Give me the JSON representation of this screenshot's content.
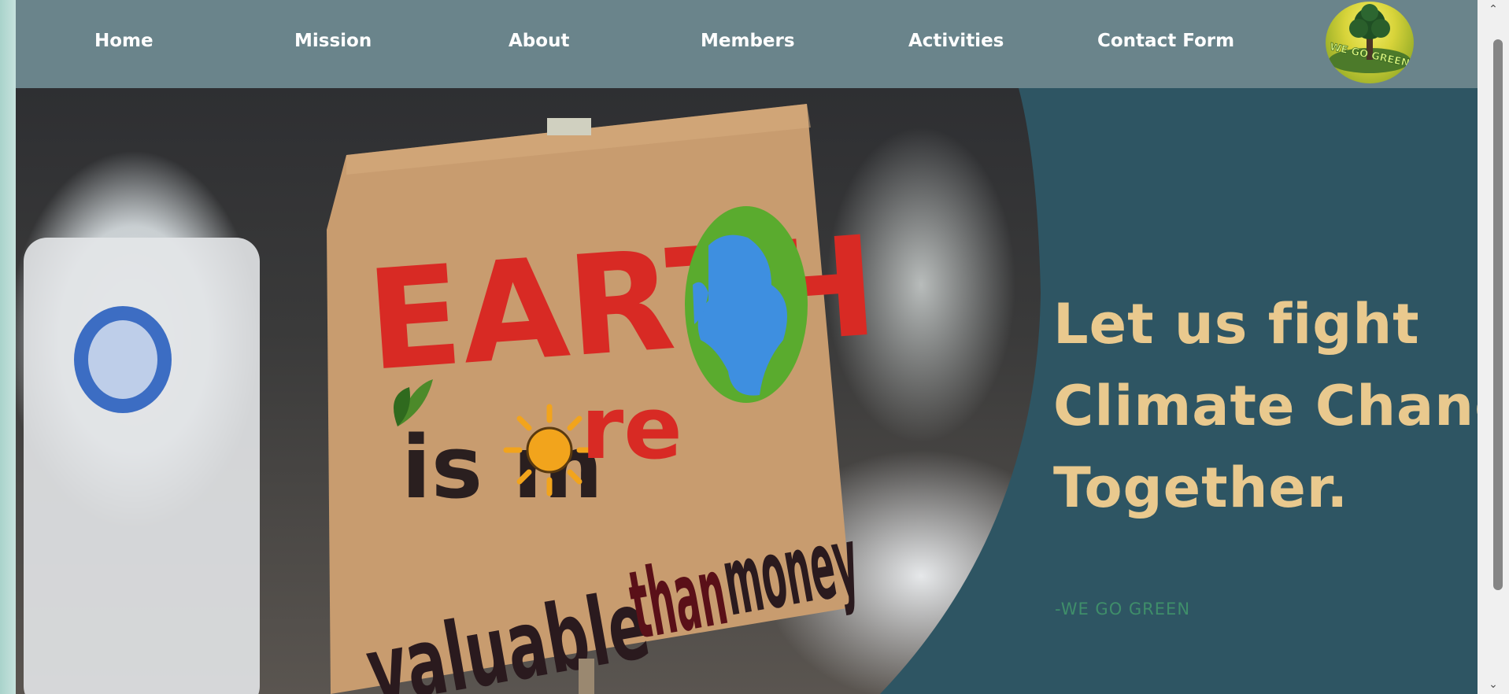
{
  "nav": {
    "items": [
      {
        "label": "Home"
      },
      {
        "label": "Mission"
      },
      {
        "label": "About"
      },
      {
        "label": "Members"
      },
      {
        "label": "Activities"
      },
      {
        "label": "Contact Form"
      }
    ],
    "logo_text": "WE GO GREEN"
  },
  "hero": {
    "sign": {
      "line1": "EARTH",
      "line2_a": "is m",
      "line2_b": "re",
      "line3_a": "valuable",
      "line3_b": "than",
      "line3_c": "money"
    },
    "headline": [
      "Let us fight",
      "Climate Change",
      "Together."
    ],
    "signature": "-WE GO GREEN"
  },
  "colors": {
    "navbar": "#6a848b",
    "panel": "#2e5563",
    "headline": "#e9c98e",
    "signature": "#3f8e6a"
  },
  "icons": {
    "scroll_up": "chevron-up-icon",
    "scroll_down": "chevron-down-icon"
  }
}
